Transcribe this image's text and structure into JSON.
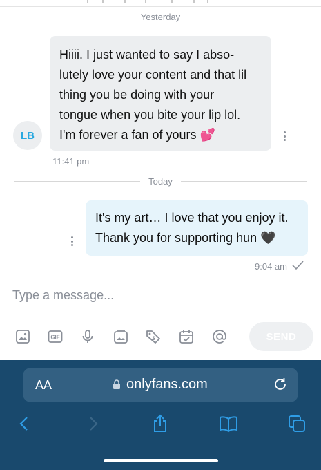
{
  "dividers": {
    "yesterday": "Yesterday",
    "today": "Today"
  },
  "incoming": {
    "avatar_initials": "LB",
    "lines": [
      "Hiiii. I just wanted to say I abso-",
      "lutely love your content and that lil",
      "thing you be doing with your",
      "tongue when you bite your lip lol.",
      "I'm forever a fan of yours 💕"
    ],
    "time": "11:41 pm"
  },
  "outgoing": {
    "lines": [
      "It's my art… I love that you enjoy it.",
      "Thank you for supporting hun 🖤"
    ],
    "time": "9:04 am"
  },
  "composer": {
    "placeholder": "Type a message...",
    "send_label": "SEND",
    "gif_label": "GIF",
    "tools": [
      "image-icon",
      "gif-icon",
      "microphone-icon",
      "vault-icon",
      "price-tag-icon",
      "calendar-icon",
      "mention-icon"
    ]
  },
  "browser": {
    "aa_label": "AA",
    "domain": "onlyfans.com",
    "accent_color": "#19496d",
    "nav": [
      "back-icon",
      "forward-icon",
      "share-icon",
      "bookmarks-icon",
      "tabs-icon"
    ]
  },
  "colors": {
    "accent": "#2aa9e0",
    "incoming_bubble": "#eceef0",
    "outgoing_bubble": "#e6f4fb"
  }
}
